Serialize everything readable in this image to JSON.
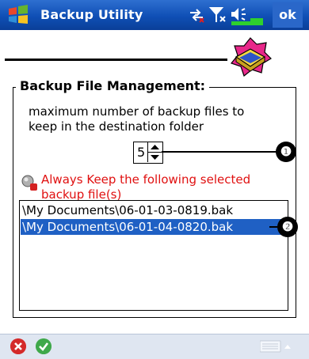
{
  "titlebar": {
    "title": "Backup Utility",
    "ok_label": "ok"
  },
  "group": {
    "title": "Backup File Management:",
    "description": "maximum number of backup files to keep in the destination folder",
    "max_files_value": "5",
    "keep_label": "Always Keep the following selected backup file(s)"
  },
  "files": [
    {
      "name": "\\My Documents\\06-01-03-0819.bak",
      "selected": false
    },
    {
      "name": "\\My Documents\\06-01-04-0820.bak",
      "selected": true
    }
  ],
  "callouts": [
    "❶",
    "❷"
  ],
  "icons": {
    "windows_logo": "windows-start-icon",
    "connectivity": "connectivity-icon",
    "signal": "signal-icon",
    "volume": "volume-icon",
    "battery": "battery-icon",
    "app": "backup-app-icon",
    "keep": "keep-files-icon",
    "cancel": "cancel-icon",
    "confirm": "confirm-icon",
    "keyboard": "keyboard-icon"
  },
  "colors": {
    "titlebar": "#0f4fb5",
    "selection": "#1f60c4",
    "keep_text": "#e01010",
    "bottombar": "#dfe6f1"
  }
}
